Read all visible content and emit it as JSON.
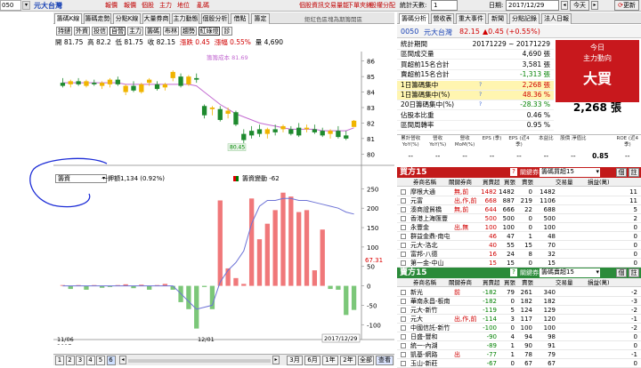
{
  "topbar": {
    "stock_code": "050",
    "stock_name": "元大台灣",
    "menu": [
      "報價",
      "報價",
      "個股",
      "主力",
      "地位",
      "亂碼"
    ],
    "right_links": [
      "個股資訊",
      "交易量能",
      "下單夾錶",
      "股權分配"
    ],
    "count_label": "統計天數:",
    "count_value": "1",
    "date_label": "日期:",
    "date_value": "2017/12/29",
    "today_button": "今天",
    "update_button": "更新"
  },
  "chart_tabs": [
    "籌碼K線",
    "籌碼走勢",
    "分點K線",
    "大量券商",
    "主力動態",
    "個股分析",
    "借點",
    "籌定"
  ],
  "chart_tab_note": "鉅紅色區塊為期籌開區",
  "chart_chips": [
    "持鏈",
    "外資",
    "投信",
    "自營",
    "主力",
    "籌碼",
    "布林",
    "趨勢",
    "紅綠燈",
    "診"
  ],
  "chart_chip_extra": "|",
  "ohlc": {
    "open_label": "開",
    "open": "81.75",
    "high_label": "高",
    "high": "82.2",
    "low_label": "低",
    "low": "81.75",
    "close_label": "收",
    "close": "82.15",
    "change_label": "漲跌",
    "change": "0.45",
    "pct_label": "漲幅",
    "pct": "0.55%",
    "vol_label": "量",
    "vol": "4,690"
  },
  "avg_cost_note": "籌籌成本 81.69",
  "ma_value_label": "80.45",
  "price_axis": [
    "86",
    "85",
    "84",
    "83",
    "82",
    "81",
    "80"
  ],
  "lower_panel": {
    "select_value": "籌資",
    "ind_label": "一鉀額",
    "ind_value": "1,134 (0.92%)",
    "legend_label": "籌資變動",
    "legend_value": "-62",
    "axis": [
      "250",
      "200",
      "150",
      "100",
      "50",
      "0",
      "-50",
      "-100"
    ],
    "current_value": "67.31"
  },
  "x_axis": {
    "start_date": "11/06",
    "start_year": "2017",
    "mid_date": "12/01",
    "end_date": "2017/12/29"
  },
  "bottom_nav": {
    "pages": [
      "1",
      "2",
      "3",
      "4",
      "5",
      "6"
    ],
    "periods": [
      "3月",
      "6月",
      "1年",
      "2年",
      "全部"
    ],
    "go_button": "查看"
  },
  "right_tabs": [
    "籌碼分析",
    "營收表",
    "重大事件",
    "新聞",
    "分點記錄",
    "法人日報"
  ],
  "stock_header": {
    "code": "0050",
    "name": "元大台灣",
    "price": "82.15",
    "change": "▲0.45 (+0.55%)"
  },
  "stats": [
    {
      "label": "統計期間",
      "value": "20171229 ~ 20171229"
    },
    {
      "label": "區間成交量",
      "value": "4,690 張"
    },
    {
      "label": "買超前15名合計",
      "value": "3,581 張"
    },
    {
      "label": "賣超前15名合計",
      "value": "-1,313 張"
    },
    {
      "label": "1日籌碼集中",
      "value": "2,268 張"
    },
    {
      "label": "1日籌碼集中(%)",
      "value": "48.36 %"
    },
    {
      "label": "20日籌碼集中(%)",
      "value": "-28.33 %"
    },
    {
      "label": "佔股本比重",
      "value": "0.46 %"
    },
    {
      "label": "區間周轉率",
      "value": "0.95 %"
    }
  ],
  "summary_box": {
    "line1": "今日",
    "line2": "主力動向",
    "verdict": "大買",
    "amount": "2,268 張"
  },
  "metrics": {
    "headers": [
      "累計營收 YoY(%)",
      "營收 YoY(%)",
      "營收 MoM(%)",
      "EPS (季)",
      "EPS (近4季)",
      "本益比",
      "股價 淨值比",
      "",
      "ROE (近4季)"
    ],
    "values": [
      "--",
      "--",
      "--",
      "--",
      "--",
      "--",
      "--",
      "0.85",
      "--"
    ]
  },
  "buy_panel": {
    "title": "買方15",
    "filter_label": "關鍵券商",
    "filter_value": "籌碼買超15",
    "btn1": "個",
    "btn2": "註",
    "columns": [
      "券商名稱",
      "關鍵券商",
      "買賣超",
      "買張",
      "賣張",
      "交易量",
      "損益(萬)"
    ],
    "rows": [
      [
        "摩根大通",
        "無,前",
        "1482",
        "1482",
        "0",
        "1482",
        "11"
      ],
      [
        "元富",
        "出,作,前",
        "668",
        "887",
        "219",
        "1106",
        "11"
      ],
      [
        "湊商證貿橋",
        "無,前",
        "644",
        "666",
        "22",
        "688",
        "5"
      ],
      [
        "香港上海匯豐",
        "",
        "500",
        "500",
        "0",
        "500",
        "2"
      ],
      [
        "永豐金",
        "出,無",
        "100",
        "100",
        "0",
        "100",
        "0"
      ],
      [
        "群益金鼎-南屯",
        "",
        "46",
        "47",
        "1",
        "48",
        "0"
      ],
      [
        "元大-洛北",
        "",
        "40",
        "55",
        "15",
        "70",
        "0"
      ],
      [
        "富邦-八德",
        "",
        "16",
        "24",
        "8",
        "32",
        "0"
      ],
      [
        "第一金-中山",
        "",
        "15",
        "15",
        "0",
        "15",
        "0"
      ]
    ]
  },
  "sell_panel": {
    "title": "賣方15",
    "filter_label": "關鍵券商",
    "filter_value": "籌碼賣超15",
    "btn1": "個",
    "btn2": "註",
    "columns": [
      "券商名稱",
      "關鍵券商",
      "買賣超",
      "買張",
      "賣張",
      "交易量",
      "損益(萬)"
    ],
    "rows": [
      [
        "新光",
        "前",
        "-182",
        "79",
        "261",
        "340",
        "-2"
      ],
      [
        "華南永昌-板南",
        "",
        "-182",
        "0",
        "182",
        "182",
        "-3"
      ],
      [
        "元大-新竹",
        "",
        "-119",
        "5",
        "124",
        "129",
        "-2"
      ],
      [
        "元大",
        "出,作,前",
        "-114",
        "3",
        "117",
        "120",
        "-1"
      ],
      [
        "中國信託-新竹",
        "",
        "-100",
        "0",
        "100",
        "100",
        "-2"
      ],
      [
        "日盛-豐和",
        "",
        "-90",
        "4",
        "94",
        "98",
        "0"
      ],
      [
        "統一-內湖",
        "",
        "-89",
        "1",
        "90",
        "91",
        "0"
      ],
      [
        "凱基-網路",
        "出",
        "-77",
        "1",
        "78",
        "79",
        "-1"
      ],
      [
        "玉山-新莊",
        "",
        "-67",
        "0",
        "67",
        "67",
        "0"
      ]
    ]
  },
  "chart_data": {
    "type": "bar",
    "title": "",
    "candles": [
      {
        "o": 84.6,
        "h": 84.9,
        "l": 84.3,
        "c": 84.4,
        "up": false
      },
      {
        "o": 84.5,
        "h": 84.8,
        "l": 84.3,
        "c": 84.7,
        "up": true
      },
      {
        "o": 84.7,
        "h": 84.9,
        "l": 84.4,
        "c": 84.5,
        "up": false
      },
      {
        "o": 84.4,
        "h": 84.8,
        "l": 84.3,
        "c": 84.7,
        "up": true
      },
      {
        "o": 84.6,
        "h": 84.8,
        "l": 84.4,
        "c": 84.5,
        "up": false
      },
      {
        "o": 84.4,
        "h": 84.7,
        "l": 84.2,
        "c": 84.6,
        "up": true
      },
      {
        "o": 84.5,
        "h": 84.9,
        "l": 84.3,
        "c": 84.8,
        "up": true
      },
      {
        "o": 84.8,
        "h": 85.0,
        "l": 84.4,
        "c": 84.5,
        "up": false
      },
      {
        "o": 84.0,
        "h": 84.5,
        "l": 83.8,
        "c": 84.4,
        "up": true
      },
      {
        "o": 84.4,
        "h": 84.7,
        "l": 84.0,
        "c": 84.1,
        "up": false
      },
      {
        "o": 84.0,
        "h": 84.6,
        "l": 83.9,
        "c": 84.5,
        "up": true
      },
      {
        "o": 84.6,
        "h": 84.9,
        "l": 84.4,
        "c": 84.8,
        "up": true
      },
      {
        "o": 84.5,
        "h": 84.7,
        "l": 84.1,
        "c": 84.2,
        "up": false
      },
      {
        "o": 84.3,
        "h": 84.6,
        "l": 84.1,
        "c": 84.5,
        "up": true
      },
      {
        "o": 84.9,
        "h": 85.4,
        "l": 84.7,
        "c": 85.3,
        "up": true
      },
      {
        "o": 85.0,
        "h": 85.2,
        "l": 84.3,
        "c": 84.4,
        "up": false
      },
      {
        "o": 84.5,
        "h": 85.1,
        "l": 84.4,
        "c": 85.0,
        "up": true
      },
      {
        "o": 84.9,
        "h": 85.2,
        "l": 84.6,
        "c": 84.8,
        "up": false
      },
      {
        "o": 83.1,
        "h": 83.2,
        "l": 82.3,
        "c": 82.5,
        "up": false
      },
      {
        "o": 82.9,
        "h": 83.1,
        "l": 82.5,
        "c": 83.0,
        "up": true
      },
      {
        "o": 82.9,
        "h": 83.1,
        "l": 82.1,
        "c": 82.2,
        "up": false
      },
      {
        "o": 82.6,
        "h": 83.0,
        "l": 82.3,
        "c": 82.8,
        "up": true
      },
      {
        "o": 82.7,
        "h": 82.8,
        "l": 81.8,
        "c": 81.9,
        "up": false
      },
      {
        "o": 81.3,
        "h": 81.6,
        "l": 80.7,
        "c": 80.9,
        "up": false
      },
      {
        "o": 81.5,
        "h": 81.8,
        "l": 81.0,
        "c": 81.2,
        "up": false
      },
      {
        "o": 81.6,
        "h": 81.9,
        "l": 81.1,
        "c": 81.3,
        "up": false
      },
      {
        "o": 81.3,
        "h": 81.7,
        "l": 81.0,
        "c": 81.6,
        "up": true
      },
      {
        "o": 81.6,
        "h": 81.9,
        "l": 81.2,
        "c": 81.4,
        "up": false
      },
      {
        "o": 81.6,
        "h": 81.9,
        "l": 81.4,
        "c": 81.8,
        "up": true
      },
      {
        "o": 81.6,
        "h": 81.8,
        "l": 81.2,
        "c": 81.3,
        "up": false
      },
      {
        "o": 81.7,
        "h": 82.0,
        "l": 81.1,
        "c": 81.2,
        "up": false
      },
      {
        "o": 81.6,
        "h": 81.9,
        "l": 81.4,
        "c": 81.7,
        "up": true
      },
      {
        "o": 81.6,
        "h": 81.9,
        "l": 81.3,
        "c": 81.4,
        "up": false
      },
      {
        "o": 81.5,
        "h": 81.7,
        "l": 81.1,
        "c": 81.2,
        "up": false
      },
      {
        "o": 81.3,
        "h": 81.6,
        "l": 81.0,
        "c": 81.5,
        "up": true
      },
      {
        "o": 81.5,
        "h": 81.8,
        "l": 81.0,
        "c": 81.1,
        "up": false
      },
      {
        "o": 81.2,
        "h": 81.5,
        "l": 80.9,
        "c": 81.0,
        "up": false
      },
      {
        "o": 81.75,
        "h": 82.2,
        "l": 81.75,
        "c": 82.15,
        "up": true
      }
    ],
    "ma": [
      84.6,
      84.6,
      84.6,
      84.6,
      84.6,
      84.6,
      84.6,
      84.6,
      84.5,
      84.5,
      84.5,
      84.5,
      84.5,
      84.5,
      84.5,
      84.5,
      84.5,
      84.4,
      84.0,
      83.6,
      83.2,
      82.9,
      82.6,
      82.4,
      82.2,
      82.0,
      81.9,
      81.8,
      81.7,
      81.6,
      81.6,
      81.6,
      81.6,
      81.5,
      81.5,
      81.5,
      81.5,
      81.69
    ],
    "price_range": [
      79.5,
      86.5
    ],
    "flow": [
      2,
      -8,
      2,
      -10,
      2,
      -5,
      -3,
      2,
      4,
      -6,
      3,
      -10,
      2,
      5,
      -10,
      -42,
      -60,
      -110,
      -3,
      -60,
      220,
      45,
      20,
      5,
      225,
      120,
      160,
      195,
      240,
      230,
      190,
      195,
      40,
      145,
      -8,
      -10,
      -75,
      -62
    ],
    "cum": [
      0,
      0,
      0,
      0,
      0,
      0,
      0,
      0,
      0,
      0,
      0,
      0,
      0,
      0,
      0,
      -20,
      -40,
      -60,
      -55,
      -50,
      10,
      40,
      60,
      90,
      160,
      205,
      220,
      220,
      225,
      225,
      220,
      220,
      215,
      210,
      205,
      200,
      190,
      185
    ],
    "flow_range": [
      -120,
      260
    ]
  }
}
